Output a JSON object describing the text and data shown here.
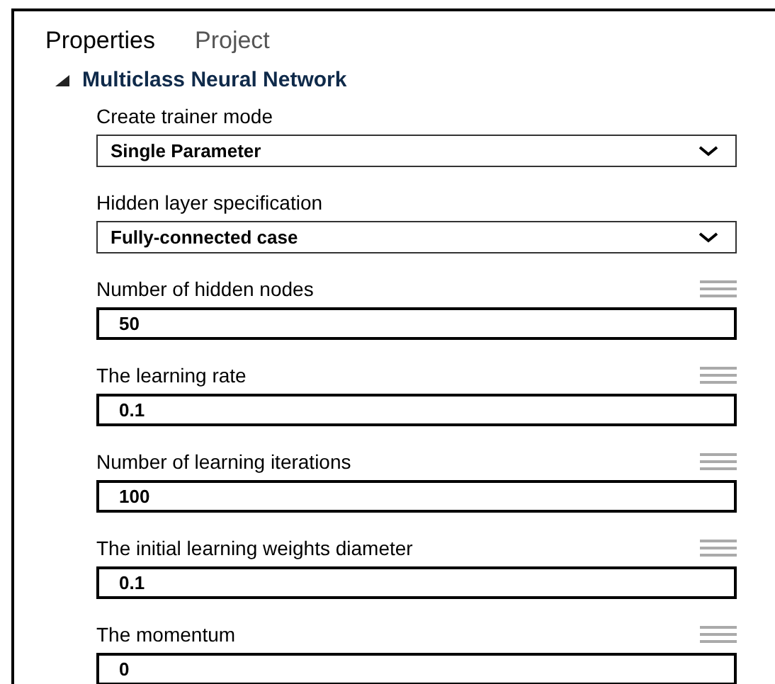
{
  "tabs": [
    {
      "label": "Properties",
      "selected": true
    },
    {
      "label": "Project",
      "selected": false
    }
  ],
  "section": {
    "title": "Multiclass Neural Network",
    "expanded": true
  },
  "fields": [
    {
      "kind": "dropdown",
      "label": "Create trainer mode",
      "value": "Single Parameter"
    },
    {
      "kind": "dropdown",
      "label": "Hidden layer specification",
      "value": "Fully-connected case"
    },
    {
      "kind": "number",
      "label": "Number of hidden nodes",
      "value": "50"
    },
    {
      "kind": "number",
      "label": "The learning rate",
      "value": "0.1"
    },
    {
      "kind": "number",
      "label": "Number of learning iterations",
      "value": "100"
    },
    {
      "kind": "number",
      "label": "The initial learning weights diameter",
      "value": "0.1"
    },
    {
      "kind": "number",
      "label": "The momentum",
      "value": "0"
    }
  ]
}
